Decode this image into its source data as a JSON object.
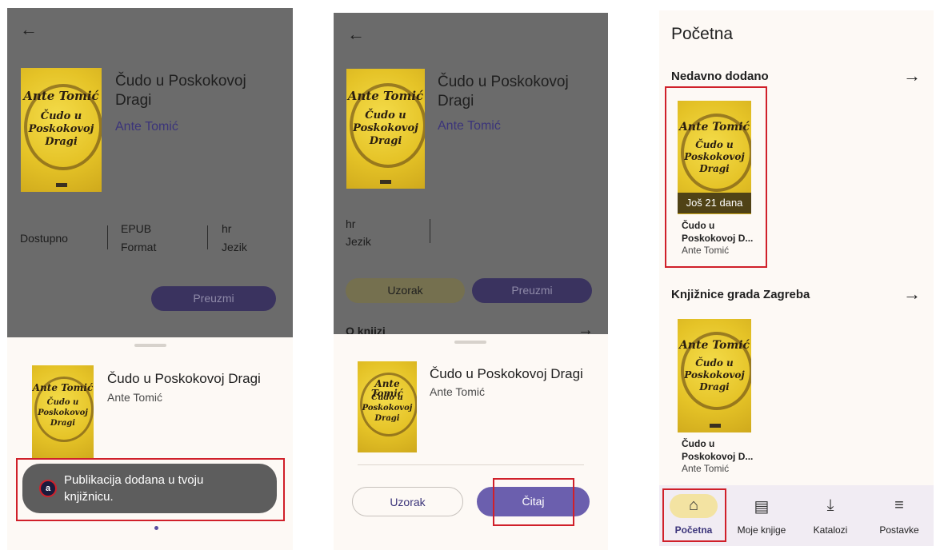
{
  "book": {
    "title": "Čudo u Poskokovoj Dragi",
    "title_line1": "Čudo u Poskokovoj",
    "title_line2": "Dragi",
    "author": "Ante Tomić",
    "cover_author": "Ante Tomić",
    "cover_title_1": "Čudo u",
    "cover_title_2": "Poskokovoj",
    "cover_title_3": "Dragi"
  },
  "panel1": {
    "availability": "Dostupno",
    "format_value": "EPUB",
    "format_label": "Format",
    "lang_value": "hr",
    "lang_label": "Jezik",
    "download_button": "Preuzmi",
    "toast_text_1": "Publikacija dodana u tvoju",
    "toast_text_2": "knjižnicu."
  },
  "panel2": {
    "lang_value": "hr",
    "lang_label": "Jezik",
    "sample_button": "Uzorak",
    "download_button": "Preuzmi",
    "about_label": "O knjizi",
    "sheet_sample_button": "Uzorak",
    "sheet_read_button": "Čitaj"
  },
  "panel3": {
    "page_title": "Početna",
    "section_recent": "Nedavno dodano",
    "section_library": "Knjižnice grada Zagreba",
    "badge": "Još 21 dana",
    "book_title_1": "Čudo u",
    "book_title_2": "Poskokovoj D...",
    "nav": {
      "home": "Početna",
      "mybooks": "Moje knjige",
      "catalogs": "Katalozi",
      "settings": "Postavke"
    }
  },
  "colors": {
    "accent": "#3b347a",
    "highlight": "#d0202a",
    "home_pill": "#f3e3a2"
  }
}
